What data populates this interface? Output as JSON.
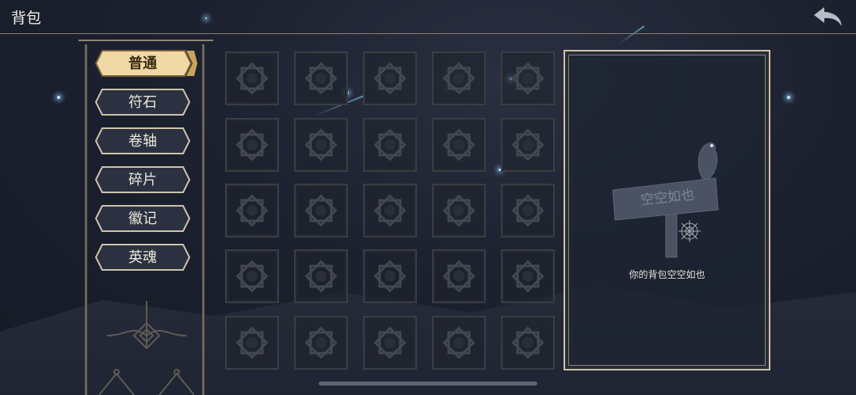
{
  "header": {
    "title": "背包",
    "back_icon": "back-arrow-icon"
  },
  "tabs": [
    {
      "label": "普通",
      "active": true
    },
    {
      "label": "符石",
      "active": false
    },
    {
      "label": "卷轴",
      "active": false
    },
    {
      "label": "碎片",
      "active": false
    },
    {
      "label": "徽记",
      "active": false
    },
    {
      "label": "英魂",
      "active": false
    }
  ],
  "inventory": {
    "rows": 5,
    "cols": 5,
    "slot_icon": "empty-slot-emblem-icon"
  },
  "detail_panel": {
    "sign_text": "空空如也",
    "empty_message": "你的背包空空如也"
  },
  "colors": {
    "active_tab": "#f0d9a4",
    "tab_border": "#cfc3ad",
    "accent_gold": "#c9a45c"
  }
}
